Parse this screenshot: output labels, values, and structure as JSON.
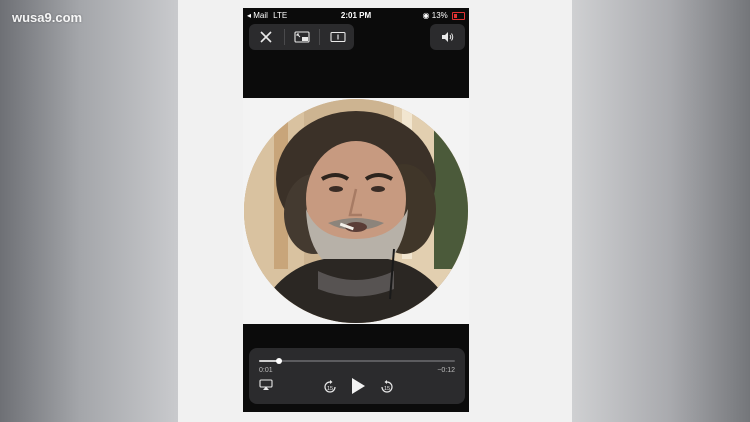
{
  "channel": {
    "logo_text": "wusa9.com"
  },
  "status_bar": {
    "back_app": "◂ Mail",
    "network": "LTE",
    "time": "2:01 PM",
    "battery": "13%",
    "battery_color": "#e03333"
  },
  "viewer_controls": {
    "close_icon": "close-icon",
    "pip_icon": "picture-in-picture-icon",
    "zoom_icon": "aspect-zoom-icon",
    "volume_icon": "speaker-volume-icon"
  },
  "playback": {
    "elapsed": "0:01",
    "remaining": "−0:12",
    "progress": 0.1,
    "airplay_icon": "airplay-icon",
    "rewind_label": "15",
    "forward_label": "15",
    "play_icon": "play-icon"
  }
}
